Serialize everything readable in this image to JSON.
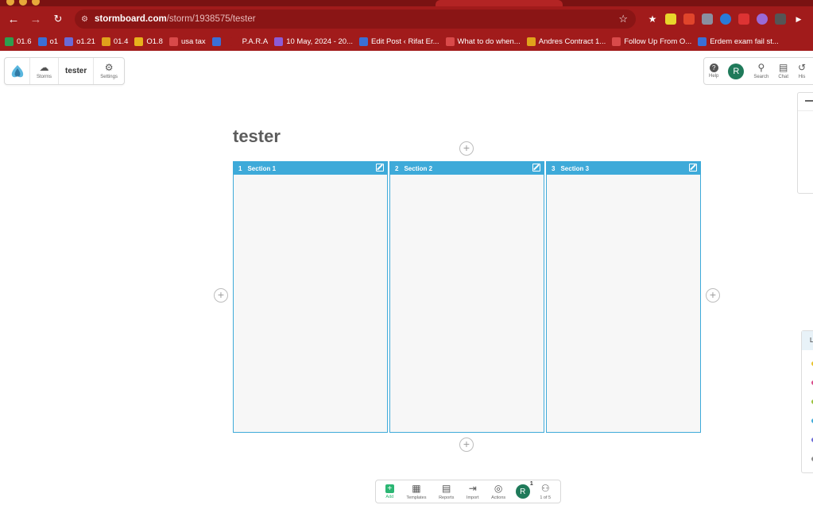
{
  "browser": {
    "url_domain": "stormboard.com",
    "url_path": "/storm/1938575/tester",
    "bookmarks": [
      {
        "label": "01.6",
        "color": "#2e9e4f"
      },
      {
        "label": "o1",
        "color": "#3b6fd6"
      },
      {
        "label": "o1.21",
        "color": "#6a6ad6"
      },
      {
        "label": "01.4",
        "color": "#e0a21b"
      },
      {
        "label": "O1.8",
        "color": "#e8b11c"
      },
      {
        "label": "usa tax",
        "color": "#d94a4a"
      },
      {
        "label": "",
        "color": "#3b6fd6"
      },
      {
        "label": "P.A.R.A",
        "color": "#a11b1b"
      },
      {
        "label": "10 May, 2024 - 20...",
        "color": "#8c5bd6"
      },
      {
        "label": "Edit Post ‹ Rifat Er...",
        "color": "#3b6fd6"
      },
      {
        "label": "What to do when...",
        "color": "#d94a4a"
      },
      {
        "label": "Andres Contract 1...",
        "color": "#e0a21b"
      },
      {
        "label": "Follow Up From O...",
        "color": "#d94a4a"
      },
      {
        "label": "Erdem exam fail st...",
        "color": "#3b6fd6"
      }
    ]
  },
  "toolbar_left": {
    "storms_label": "Storms",
    "storm_name": "tester",
    "settings_label": "Settings"
  },
  "toolbar_right": {
    "help_label": "Help",
    "avatar_letter": "R",
    "search_label": "Search",
    "chat_label": "Chat",
    "history_label": "His"
  },
  "board": {
    "title": "tester",
    "sections": [
      {
        "num": "1",
        "label": "Section 1"
      },
      {
        "num": "2",
        "label": "Section 2"
      },
      {
        "num": "3",
        "label": "Section 3"
      }
    ]
  },
  "right_panel": {
    "header_letter": "L"
  },
  "bottom_toolbar": {
    "add_label": "Add",
    "templates_label": "Templates",
    "reports_label": "Reports",
    "import_label": "Import",
    "actions_label": "Actions",
    "avatar_letter": "R",
    "avatar_badge": "1",
    "users_label": "1 of 5"
  },
  "colors": {
    "browser_chrome": "#a11b1b",
    "section_accent": "#3eaad9",
    "avatar": "#1f7a5a",
    "add_green": "#2bb673"
  }
}
